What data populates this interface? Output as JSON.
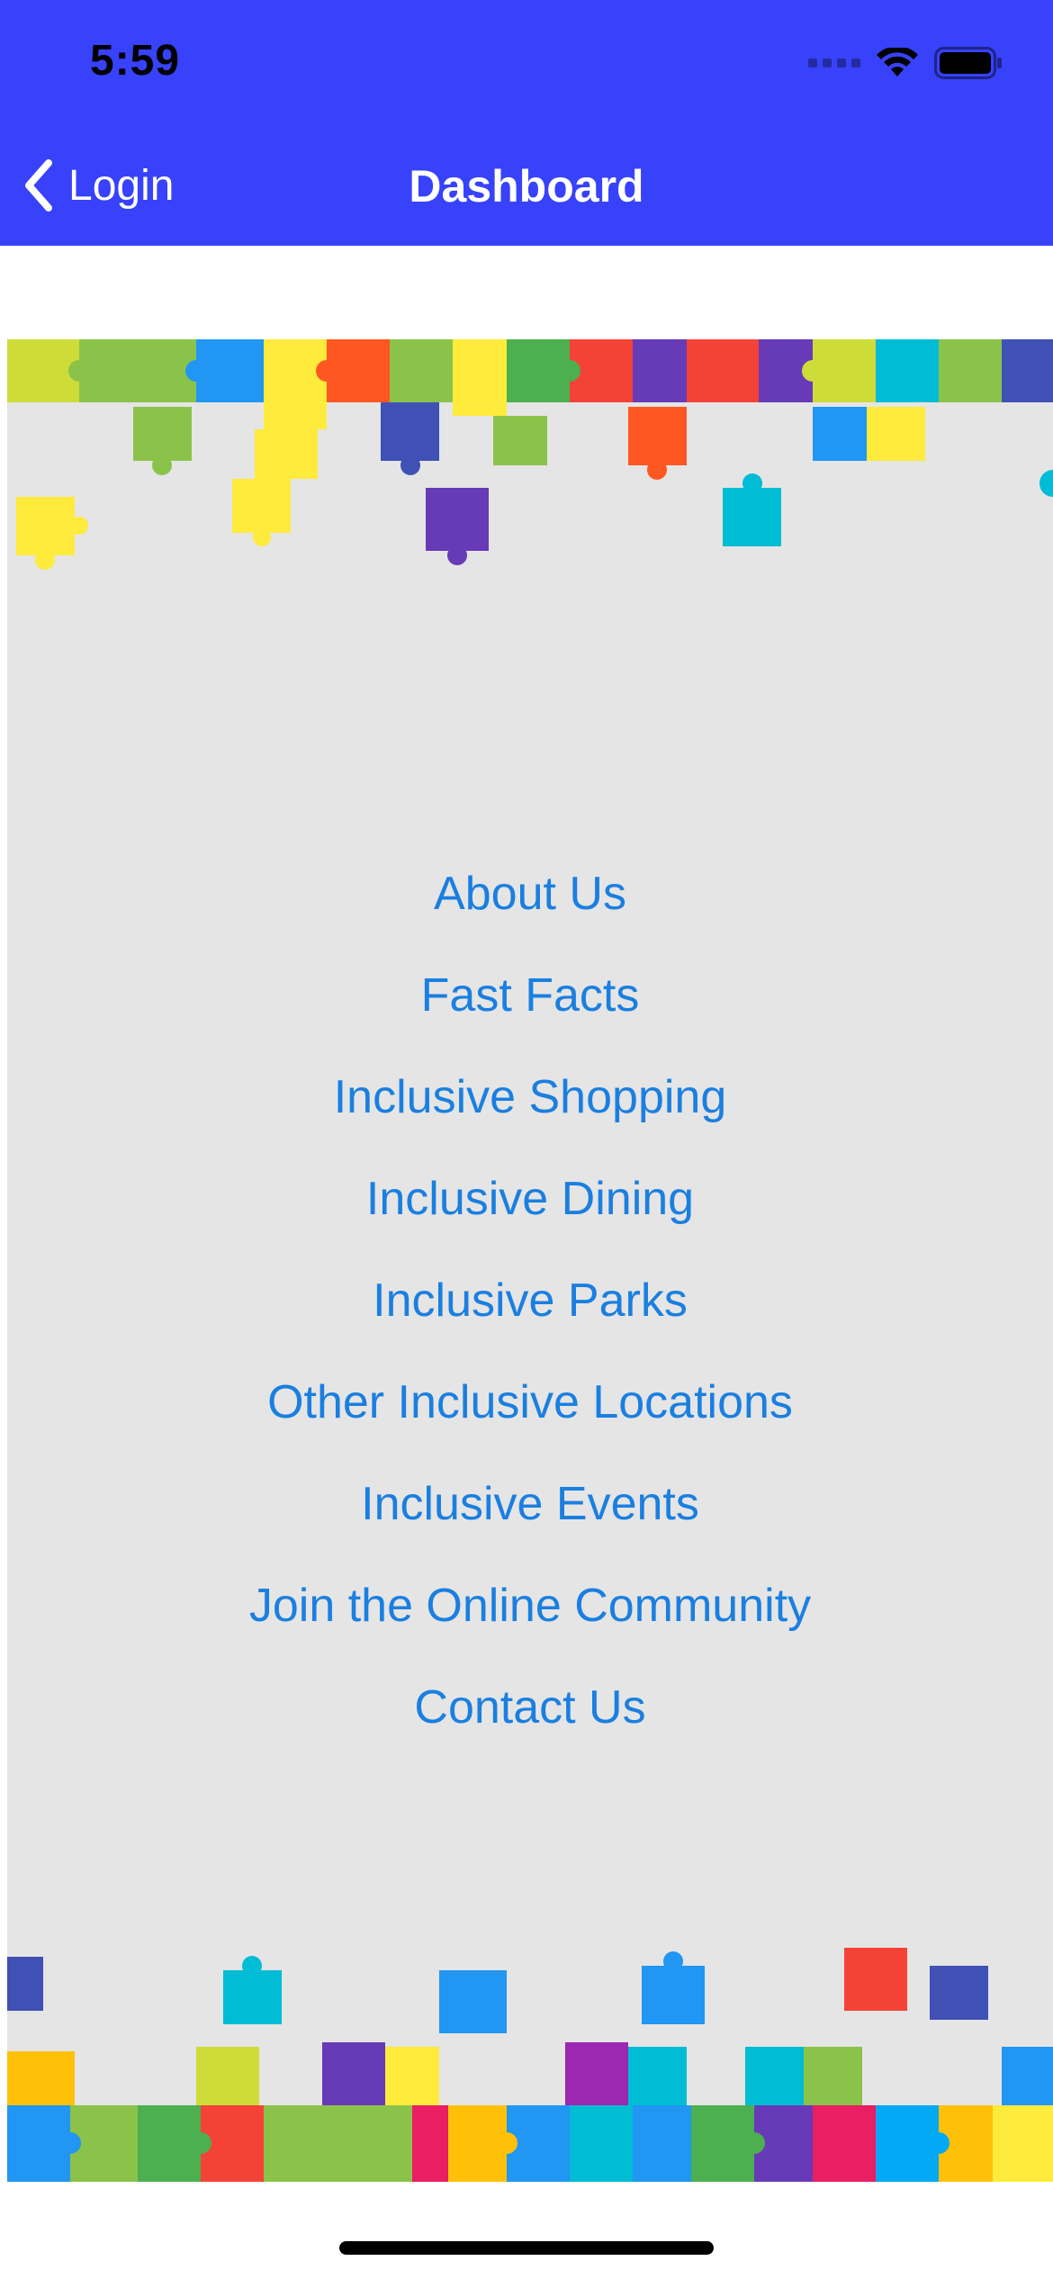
{
  "status_bar": {
    "time": "5:59",
    "signal_icon": "cellular-signal-icon",
    "wifi_icon": "wifi-icon",
    "battery_icon": "battery-icon"
  },
  "nav_bar": {
    "back_label": "Login",
    "back_icon": "chevron-left-icon",
    "title": "Dashboard",
    "background_color": "#3742FA"
  },
  "menu": {
    "link_color": "#1a7fe0",
    "items": [
      {
        "label": "About Us"
      },
      {
        "label": "Fast Facts"
      },
      {
        "label": "Inclusive Shopping"
      },
      {
        "label": "Inclusive Dining"
      },
      {
        "label": "Inclusive Parks"
      },
      {
        "label": "Other Inclusive Locations"
      },
      {
        "label": "Inclusive Events"
      },
      {
        "label": "Join the Online Community"
      },
      {
        "label": "Contact Us"
      }
    ]
  },
  "background_image": {
    "subject": "puzzle-pieces-border",
    "colors": [
      "#8bc34a",
      "#ffeb3b",
      "#2196f3",
      "#ff5722",
      "#673ab7",
      "#00bcd4",
      "#f44336",
      "#e91e63",
      "#4caf50",
      "#ffc107",
      "#3f51b5",
      "#cddc39"
    ]
  }
}
